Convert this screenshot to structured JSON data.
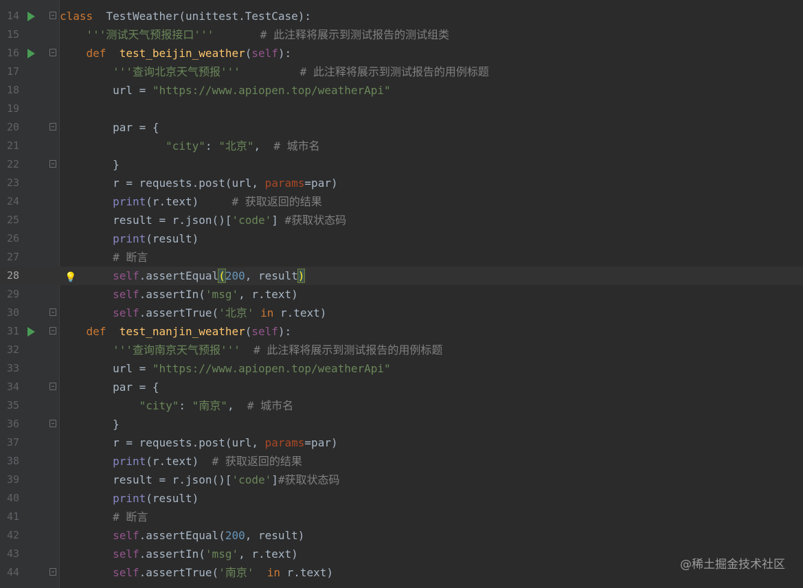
{
  "editor": {
    "top_fragment": "unittest.TestCase):",
    "lines": [
      {
        "n": "14",
        "icon": "run",
        "fold": "open",
        "segs": [
          [
            "kw",
            "class"
          ],
          [
            "",
            "  TestWeather(unittest.TestCase):"
          ]
        ]
      },
      {
        "n": "15",
        "segs": [
          [
            "",
            "    "
          ],
          [
            "str",
            "'''测试天气预报接口'''"
          ],
          [
            "",
            "       "
          ],
          [
            "cmt",
            "# 此注释将展示到测试报告的测试组类"
          ]
        ]
      },
      {
        "n": "16",
        "icon": "run",
        "fold": "open",
        "segs": [
          [
            "",
            "    "
          ],
          [
            "kw",
            "def"
          ],
          [
            "",
            "  "
          ],
          [
            "fn",
            "test_beijin_weather"
          ],
          [
            "",
            "("
          ],
          [
            "self",
            "self"
          ],
          [
            "",
            "):"
          ]
        ]
      },
      {
        "n": "17",
        "segs": [
          [
            "",
            "        "
          ],
          [
            "str",
            "'''查询北京天气预报'''"
          ],
          [
            "",
            "         "
          ],
          [
            "cmt",
            "# 此注释将展示到测试报告的用例标题"
          ]
        ]
      },
      {
        "n": "18",
        "segs": [
          [
            "",
            "        url = "
          ],
          [
            "str",
            "\"https://www.apiopen.top/weatherApi\""
          ]
        ]
      },
      {
        "n": "19",
        "segs": []
      },
      {
        "n": "20",
        "fold": "open",
        "segs": [
          [
            "",
            "        par = {"
          ]
        ]
      },
      {
        "n": "21",
        "segs": [
          [
            "",
            "                "
          ],
          [
            "str",
            "\"city\""
          ],
          [
            "",
            ": "
          ],
          [
            "str",
            "\"北京\""
          ],
          [
            "",
            ",  "
          ],
          [
            "cmt",
            "# 城市名"
          ]
        ]
      },
      {
        "n": "22",
        "fold": "close",
        "segs": [
          [
            "",
            "        }"
          ]
        ]
      },
      {
        "n": "23",
        "segs": [
          [
            "",
            "        r = requests.post(url, "
          ],
          [
            "param",
            "params"
          ],
          [
            "",
            "=par)"
          ]
        ]
      },
      {
        "n": "24",
        "segs": [
          [
            "",
            "        "
          ],
          [
            "bi",
            "print"
          ],
          [
            "",
            "(r.text)     "
          ],
          [
            "cmt",
            "# 获取返回的结果"
          ]
        ]
      },
      {
        "n": "25",
        "segs": [
          [
            "",
            "        result = r.json()["
          ],
          [
            "str",
            "'code'"
          ],
          [
            "",
            "] "
          ],
          [
            "cmt",
            "#获取状态码"
          ]
        ]
      },
      {
        "n": "26",
        "segs": [
          [
            "",
            "        "
          ],
          [
            "bi",
            "print"
          ],
          [
            "",
            "(result)"
          ]
        ]
      },
      {
        "n": "27",
        "segs": [
          [
            "",
            "        "
          ],
          [
            "cmt",
            "# 断言"
          ]
        ]
      },
      {
        "n": "28",
        "current": true,
        "bulb": true,
        "segs": [
          [
            "",
            "        "
          ],
          [
            "self",
            "self"
          ],
          [
            "",
            ".assertEqual"
          ],
          [
            "hl",
            "("
          ],
          [
            "num",
            "200"
          ],
          [
            "",
            ", result"
          ],
          [
            "hl",
            ")"
          ]
        ]
      },
      {
        "n": "29",
        "segs": [
          [
            "",
            "        "
          ],
          [
            "self",
            "self"
          ],
          [
            "",
            ".assertIn("
          ],
          [
            "str",
            "'msg'"
          ],
          [
            "",
            ", r.text)"
          ]
        ]
      },
      {
        "n": "30",
        "fold": "close",
        "segs": [
          [
            "",
            "        "
          ],
          [
            "self",
            "self"
          ],
          [
            "",
            ".assertTrue("
          ],
          [
            "str",
            "'北京'"
          ],
          [
            "kw",
            " in"
          ],
          [
            "",
            " r.text)"
          ]
        ]
      },
      {
        "n": "31",
        "icon": "run",
        "fold": "open",
        "segs": [
          [
            "",
            "    "
          ],
          [
            "kw",
            "def"
          ],
          [
            "",
            "  "
          ],
          [
            "fn",
            "test_nanjin_weather"
          ],
          [
            "",
            "("
          ],
          [
            "self",
            "self"
          ],
          [
            "",
            "):"
          ]
        ]
      },
      {
        "n": "32",
        "segs": [
          [
            "",
            "        "
          ],
          [
            "str",
            "'''查询南京天气预报'''"
          ],
          [
            "",
            "  "
          ],
          [
            "cmt",
            "# 此注释将展示到测试报告的用例标题"
          ]
        ]
      },
      {
        "n": "33",
        "segs": [
          [
            "",
            "        url = "
          ],
          [
            "str",
            "\"https://www.apiopen.top/weatherApi\""
          ]
        ]
      },
      {
        "n": "34",
        "fold": "open",
        "segs": [
          [
            "",
            "        par = {"
          ]
        ]
      },
      {
        "n": "35",
        "segs": [
          [
            "",
            "            "
          ],
          [
            "str",
            "\"city\""
          ],
          [
            "",
            ": "
          ],
          [
            "str",
            "\"南京\""
          ],
          [
            "",
            ",  "
          ],
          [
            "cmt",
            "# 城市名"
          ]
        ]
      },
      {
        "n": "36",
        "fold": "close",
        "segs": [
          [
            "",
            "        }"
          ]
        ]
      },
      {
        "n": "37",
        "segs": [
          [
            "",
            "        r = requests.post(url, "
          ],
          [
            "param",
            "params"
          ],
          [
            "",
            "=par)"
          ]
        ]
      },
      {
        "n": "38",
        "segs": [
          [
            "",
            "        "
          ],
          [
            "bi",
            "print"
          ],
          [
            "",
            "(r.text)  "
          ],
          [
            "cmt",
            "# 获取返回的结果"
          ]
        ]
      },
      {
        "n": "39",
        "segs": [
          [
            "",
            "        result = r.json()["
          ],
          [
            "str",
            "'code'"
          ],
          [
            "",
            "]"
          ],
          [
            "cmt",
            "#获取状态码"
          ]
        ]
      },
      {
        "n": "40",
        "segs": [
          [
            "",
            "        "
          ],
          [
            "bi",
            "print"
          ],
          [
            "",
            "(result)"
          ]
        ]
      },
      {
        "n": "41",
        "segs": [
          [
            "",
            "        "
          ],
          [
            "cmt",
            "# 断言"
          ]
        ]
      },
      {
        "n": "42",
        "segs": [
          [
            "",
            "        "
          ],
          [
            "self",
            "self"
          ],
          [
            "",
            ".assertEqual("
          ],
          [
            "num",
            "200"
          ],
          [
            "",
            ", result)"
          ]
        ]
      },
      {
        "n": "43",
        "segs": [
          [
            "",
            "        "
          ],
          [
            "self",
            "self"
          ],
          [
            "",
            ".assertIn("
          ],
          [
            "str",
            "'msg'"
          ],
          [
            "",
            ", r.text)"
          ]
        ]
      },
      {
        "n": "44",
        "fold": "close",
        "segs": [
          [
            "",
            "        "
          ],
          [
            "self",
            "self"
          ],
          [
            "",
            ".assertTrue("
          ],
          [
            "str",
            "'南京'"
          ],
          [
            "kw",
            "  in"
          ],
          [
            "",
            " r.text)"
          ]
        ]
      }
    ]
  },
  "watermark": "@稀土掘金技术社区",
  "colors": {
    "background": "#2b2b2b",
    "gutter": "#313335",
    "keyword": "#cc7832",
    "string": "#6a8759",
    "comment": "#808080",
    "number": "#6897bb",
    "self": "#94558d",
    "function": "#ffc66d",
    "builtin": "#8888c6",
    "param": "#aa4926"
  }
}
